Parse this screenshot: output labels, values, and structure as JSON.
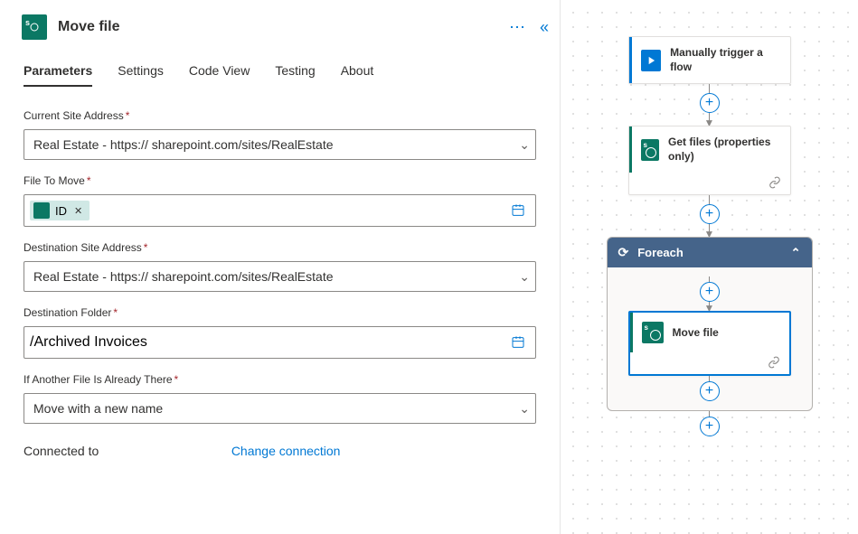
{
  "panel": {
    "title": "Move file"
  },
  "tabs": {
    "parameters": "Parameters",
    "settings": "Settings",
    "codeview": "Code View",
    "testing": "Testing",
    "about": "About"
  },
  "fields": {
    "site_label": "Current Site Address",
    "site_value": "Real Estate - https://                         sharepoint.com/sites/RealEstate",
    "file_label": "File To Move",
    "file_token": "ID",
    "dest_site_label": "Destination Site Address",
    "dest_site_value": "Real Estate - https://                         sharepoint.com/sites/RealEstate",
    "dest_folder_label": "Destination Folder",
    "dest_folder_value": "/Archived  Invoices",
    "overwrite_label": "If Another File Is Already There",
    "overwrite_value": "Move with a new name"
  },
  "footer": {
    "connected": "Connected to",
    "change": "Change connection"
  },
  "flow": {
    "trigger": "Manually trigger a flow",
    "getfiles": "Get files (properties only)",
    "foreach": "Foreach",
    "movefile": "Move file"
  }
}
